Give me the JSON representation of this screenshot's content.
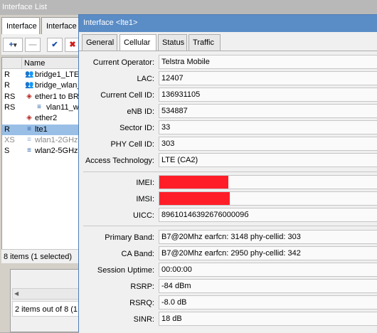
{
  "back_window": {
    "title": "Interface List",
    "tabs": [
      "Interface",
      "Interface"
    ],
    "toolbar": {
      "add": "+",
      "add_arrow": "▾",
      "remove": "—",
      "enable": "✔",
      "disable": "✖"
    },
    "list": {
      "columns": [
        "",
        "Name"
      ],
      "rows": [
        {
          "flag": "R",
          "name": "bridge1_LTE",
          "icon": "bridge-icon",
          "indent": false,
          "selected": false,
          "disabled": false
        },
        {
          "flag": "R",
          "name": "bridge_wlan_",
          "icon": "bridge-icon",
          "indent": false,
          "selected": false,
          "disabled": false
        },
        {
          "flag": "RS",
          "name": "ether1 to BR",
          "icon": "ethernet-icon",
          "indent": false,
          "selected": false,
          "disabled": false
        },
        {
          "flag": "RS",
          "name": "vlan11_w",
          "icon": "vlan-icon",
          "indent": true,
          "selected": false,
          "disabled": false
        },
        {
          "flag": "",
          "name": "ether2",
          "icon": "ethernet-icon",
          "indent": false,
          "selected": false,
          "disabled": false
        },
        {
          "flag": "R",
          "name": "lte1",
          "icon": "lte-icon",
          "indent": false,
          "selected": true,
          "disabled": false
        },
        {
          "flag": "XS",
          "name": "wlan1-2GHz",
          "icon": "wireless-icon",
          "indent": false,
          "selected": false,
          "disabled": true
        },
        {
          "flag": "S",
          "name": "wlan2-5GHz",
          "icon": "wireless-icon",
          "indent": false,
          "selected": false,
          "disabled": false
        }
      ],
      "status": "8 items (1 selected)"
    },
    "second_status": "2 items out of 8 (1 s"
  },
  "dialog": {
    "title": "Interface <lte1>",
    "tabs": [
      "General",
      "Cellular",
      "Status",
      "Traffic"
    ],
    "active_tab": "Cellular",
    "fields": {
      "current_operator": {
        "label": "Current Operator:",
        "value": "Telstra Mobile"
      },
      "lac": {
        "label": "LAC:",
        "value": "12407"
      },
      "current_cell_id": {
        "label": "Current Cell ID:",
        "value": "136931105"
      },
      "enb_id": {
        "label": "eNB ID:",
        "value": "534887"
      },
      "sector_id": {
        "label": "Sector ID:",
        "value": "33"
      },
      "phy_cell_id": {
        "label": "PHY Cell ID:",
        "value": "303"
      },
      "access_technology": {
        "label": "Access Technology:",
        "value": "LTE (CA2)"
      },
      "imei": {
        "label": "IMEI:",
        "value": ""
      },
      "imsi": {
        "label": "IMSI:",
        "value": ""
      },
      "uicc": {
        "label": "UICC:",
        "value": "8961014639267600009б"
      },
      "primary_band": {
        "label": "Primary Band:",
        "value": "B7@20Mhz earfcn: 3148 phy-cellid: 303"
      },
      "ca_band": {
        "label": "CA Band:",
        "value": "B7@20Mhz earfcn: 2950 phy-cellid: 342"
      },
      "session_uptime": {
        "label": "Session Uptime:",
        "value": "00:00:00"
      },
      "rsrp": {
        "label": "RSRP:",
        "value": "-84 dBm"
      },
      "rsrq": {
        "label": "RSRQ:",
        "value": "-8.0 dB"
      },
      "sinr": {
        "label": "SINR:",
        "value": "18 dB"
      }
    },
    "redaction_color": "#ff1e28"
  }
}
